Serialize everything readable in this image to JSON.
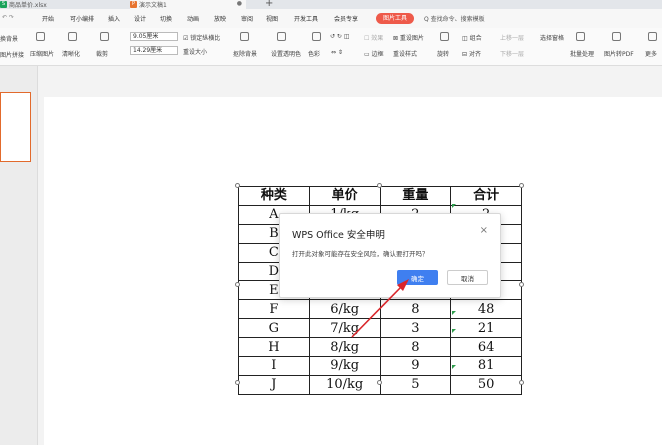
{
  "tabs": [
    {
      "label": "商品单价.xlsx"
    },
    {
      "label": "演示文稿1"
    }
  ],
  "menu": [
    "开始",
    "插入",
    "设计",
    "切换",
    "动画",
    "放映",
    "审阅",
    "视图",
    "开发工具",
    "会员专享"
  ],
  "partial_menu": "开始",
  "partial_menu2": "可小编排",
  "context_tab": "图片工具",
  "search_placeholder": "Q 查找命令、搜索模板",
  "ribbon": {
    "left_cut_1": "换背景",
    "left_cut_2": "图片拼接",
    "compress": "压缩图片",
    "clarify": "清晰化",
    "crop": "裁剪",
    "height": "9.05厘米",
    "width": "14.29厘米",
    "lock_ratio": "锁定纵横比",
    "reset_size": "重设大小",
    "matting": "抠除背景",
    "set_transparent": "设置透明色",
    "color": "色彩",
    "effect": "效果",
    "border": "边框",
    "reset_style": "重设样式",
    "combine": "组合",
    "select": "选择窗格",
    "align": "对齐",
    "rotate": "旋转",
    "up_layer": "上移一层",
    "down_layer": "下移一层",
    "batch": "批量处理",
    "to_pdf": "图片转PDF",
    "more": "更多"
  },
  "table": {
    "headers": [
      "种类",
      "单价",
      "重量",
      "合计"
    ],
    "rows": [
      [
        "A",
        "1/kg",
        "2",
        "2"
      ],
      [
        "B",
        "",
        "",
        ""
      ],
      [
        "C",
        "",
        "",
        ""
      ],
      [
        "D",
        "",
        "",
        ""
      ],
      [
        "E",
        "",
        "",
        ""
      ],
      [
        "F",
        "6/kg",
        "8",
        "48"
      ],
      [
        "G",
        "7/kg",
        "3",
        "21"
      ],
      [
        "H",
        "8/kg",
        "8",
        "64"
      ],
      [
        "I",
        "9/kg",
        "9",
        "81"
      ],
      [
        "J",
        "10/kg",
        "5",
        "50"
      ]
    ]
  },
  "dialog": {
    "title": "WPS Office 安全申明",
    "message": "打开此对象可能存在安全风险，确认要打开吗？",
    "ok": "确定",
    "cancel": "取消",
    "close": "×"
  },
  "colors": {
    "accent": "#3f7ff0",
    "context_tab": "#ee5a4a",
    "arrow": "#d9262b"
  }
}
